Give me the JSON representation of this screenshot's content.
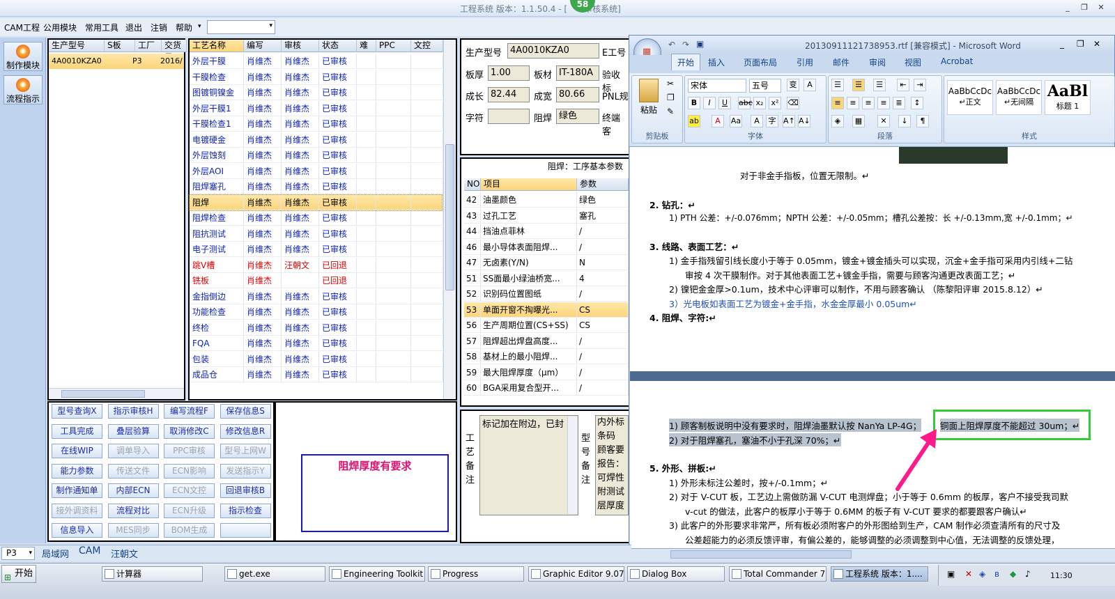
{
  "window": {
    "title": "工程系统  版本：1.1.50.4 - [    审核系统]",
    "notify_count": "58"
  },
  "menu": {
    "items": [
      "CAM工程",
      "公用模块",
      "常用工具",
      "退出",
      "注销",
      "帮助"
    ]
  },
  "toolstrip": {
    "btn1": "制作模块",
    "btn2": "流程指示"
  },
  "orders": {
    "headers": [
      "生产型号",
      "S板",
      "工厂",
      "交货日"
    ],
    "row": [
      "4A0010KZA0",
      "",
      "P3",
      "2016/"
    ]
  },
  "process": {
    "headers": [
      "工艺名称",
      "编写",
      "审核",
      "状态",
      "难",
      "PPC",
      "文控"
    ],
    "rows": [
      [
        "外层干膜",
        "肖维杰",
        "肖维杰",
        "已审核"
      ],
      [
        "干膜检查",
        "肖维杰",
        "肖维杰",
        "已审核"
      ],
      [
        "图镀铜镍金",
        "肖维杰",
        "肖维杰",
        "已审核"
      ],
      [
        "外层干膜1",
        "肖维杰",
        "肖维杰",
        "已审核"
      ],
      [
        "干膜检查1",
        "肖维杰",
        "肖维杰",
        "已审核"
      ],
      [
        "电镀硬金",
        "肖维杰",
        "肖维杰",
        "已审核"
      ],
      [
        "外层蚀刻",
        "肖维杰",
        "肖维杰",
        "已审核"
      ],
      [
        "外层AOI",
        "肖维杰",
        "肖维杰",
        "已审核"
      ],
      [
        "阻焊塞孔",
        "肖维杰",
        "肖维杰",
        "已审核"
      ],
      [
        "阻焊",
        "肖维杰",
        "肖维杰",
        "已审核"
      ],
      [
        "阻焊检查",
        "肖维杰",
        "肖维杰",
        "已审核"
      ],
      [
        "阻抗测试",
        "肖维杰",
        "肖维杰",
        "已审核"
      ],
      [
        "电子测试",
        "肖维杰",
        "肖维杰",
        "已审核"
      ],
      [
        "跳V槽",
        "肖维杰",
        "汪朝文",
        "已回退"
      ],
      [
        "铣板",
        "肖维杰",
        "",
        "已回退"
      ],
      [
        "金指倒边",
        "肖维杰",
        "肖维杰",
        "已审核"
      ],
      [
        "功能检查",
        "肖维杰",
        "肖维杰",
        "已审核"
      ],
      [
        "终检",
        "肖维杰",
        "肖维杰",
        "已审核"
      ],
      [
        "FQA",
        "肖维杰",
        "肖维杰",
        "已审核"
      ],
      [
        "包装",
        "肖维杰",
        "肖维杰",
        "已审核"
      ],
      [
        "成品仓",
        "肖维杰",
        "肖维杰",
        "已审核"
      ]
    ]
  },
  "buttons": [
    [
      "型号查询X",
      "指示审核H",
      "编写流程F",
      "保存信息S"
    ],
    [
      "工具完成",
      "叠层验算",
      "取消修改C",
      "修改信息R"
    ],
    [
      "在线WIP",
      "调单导入",
      "PPC审核",
      "型号上网W"
    ],
    [
      "能力参数",
      "传送文件",
      "ECN影响",
      "发送指示Y"
    ],
    [
      "制作通知单",
      "内部ECN",
      "ECN文控",
      "回退审核B"
    ],
    [
      "接外调资料",
      "流程对比",
      "ECN升级",
      "指示检查"
    ],
    [
      "信息导入",
      "MES同步",
      "BOM生成",
      ""
    ]
  ],
  "note_box": {
    "text": "阻焊厚度有要求"
  },
  "info": {
    "prod_label": "生产型号",
    "prod_value": "4A0010KZA0",
    "e_label": "E工号",
    "thick_label": "板厚",
    "thick_value": "1.00",
    "mat_label": "板材",
    "mat_value": "IT-180A",
    "accept_label": "验收标",
    "len_label": "成长",
    "len_value": "82.44",
    "wid_label": "成宽",
    "wid_value": "80.66",
    "pnl_label": "PNL规",
    "char_label": "字符",
    "char_value": "",
    "mask_label": "阻焊",
    "mask_value": "绿色",
    "end_label": "终端客"
  },
  "params": {
    "title": "阻焊：工序基本参数",
    "headers": [
      "NO",
      "项目",
      "参数"
    ],
    "rows": [
      [
        "42",
        "油墨颜色",
        "绿色"
      ],
      [
        "43",
        "过孔工艺",
        "塞孔"
      ],
      [
        "44",
        "挡油点菲林",
        "/"
      ],
      [
        "46",
        "最小导体表面阻焊...",
        "/"
      ],
      [
        "47",
        "无卤素(Y/N)",
        "N"
      ],
      [
        "51",
        "SS面最小绿油桥宽...",
        "4"
      ],
      [
        "52",
        "识别码位置图纸",
        "/"
      ],
      [
        "53",
        "单面开窗不掏曝光...",
        "CS"
      ],
      [
        "56",
        "生产周期位置(CS+SS)",
        "CS"
      ],
      [
        "57",
        "阻焊超出焊盘高度...",
        "/"
      ],
      [
        "58",
        "基材上的最小阻焊...",
        "/"
      ],
      [
        "59",
        "最大阻焊厚度（μm）",
        "/"
      ],
      [
        "60",
        "BGA采用复合型开...",
        "/"
      ]
    ]
  },
  "remarks": {
    "craft_label": "工艺备注",
    "craft_text": "标记加在附边，已封",
    "model_label": "型号备注",
    "model_lines": [
      "内外标",
      "条码",
      "顾客要",
      "报告：",
      "可焊性",
      "附测试",
      "层厚度"
    ]
  },
  "bottom_tabs": {
    "combo": "P3",
    "tabs": [
      "局域网",
      "CAM",
      "汪朝文"
    ]
  },
  "word": {
    "title": "20130911121738953.rtf [兼容模式] - Microsoft Word",
    "tabs": [
      "开始",
      "插入",
      "页面布局",
      "引用",
      "邮件",
      "审阅",
      "视图",
      "Acrobat"
    ],
    "font_name": "宋体",
    "font_size": "五号",
    "groups": [
      "剪贴板",
      "字体",
      "段落",
      "样式"
    ],
    "paste_label": "粘贴",
    "styles": [
      [
        "AaBbCcDc",
        "↵正文"
      ],
      [
        "AaBbCcDc",
        "↵无间隔"
      ],
      [
        "AaBl",
        "标题 1"
      ]
    ],
    "doc": {
      "l1": "对于非金手指板，位置无限制。↵",
      "h2": "2.  钻孔：↵",
      "l2": "1)  PTH 公差：+/-0.076mm；NPTH 公差：+/-0.05mm；槽孔公差按：长 +/-0.13mm,宽 +/-0.1mm；↵",
      "h3": "3.  线路、表面工艺：↵",
      "l3a": "1)  金手指残留引线长度小于等于 0.05mm，镀金+镀金插头可以实现，沉金+金手指可采用内引线+二钻",
      "l3b": "审按 4 次干膜制作。对于其他表面工艺+镀金手指，需要与顾客沟通更改表面工艺；↵",
      "l3c": "2)  镍钯金金厚>0.1um，技术中心评审可以制作，不用与顾客确认 （陈黎阳评审 2015.8.12）↵",
      "l3d": "3）光电板如表面工艺为镀金+金手指，水金金厚最小 0.05um↵",
      "h4": "4.  阻焊、字符:↵",
      "l4a1": "1)  顾客制板说明中没有要求时，阻焊油墨默认按 NanYa LP-4G；",
      "l4a2": "铜面上阻焊厚度不能超过 30um；↵",
      "l4b": "2)  对于阻焊塞孔，塞油不小于孔深 70%；↵",
      "h5": "5.  外形、拼板:↵",
      "l5a": "1)  外形未标注公差时，按+/-0.1mm；↵",
      "l5b": "2)  对于 V-CUT 板，工艺边上需做防漏 V-CUT 电测焊盘；小于等于 0.6mm 的板厚，客户不接受我司默",
      "l5c": "v-cut 的做法，此客户的板厚小于等于 0.6MM 的板子有 V-CUT 要求的都要跟客户确认↵",
      "l5d": "3)  此客户的外形要求非常严，所有板必须附客户的外形图给到生产，CAM 制作必须查清所有的尺寸及",
      "l5e": "公差超能力的必须反馈评审，有偏公差的，能够调整的必须调整到中心值，无法调整的反馈处理，"
    }
  },
  "taskbar": {
    "start": "开始",
    "tasks": [
      "计算器",
      "get.exe",
      "Engineering Toolkit 9....",
      "Progress",
      "Graphic Editor 9.07b2...",
      "Dialog Box",
      "Total Commander 7.0 ...",
      "工程系统  版本：1...."
    ],
    "clock": "11:30"
  },
  "colors": {
    "accent": "#fbd57a",
    "highlight_green": "#33cc33",
    "arrow_pink": "#ff1a8c",
    "note_red": "#e0106e",
    "note_border": "#1a1ab0"
  }
}
